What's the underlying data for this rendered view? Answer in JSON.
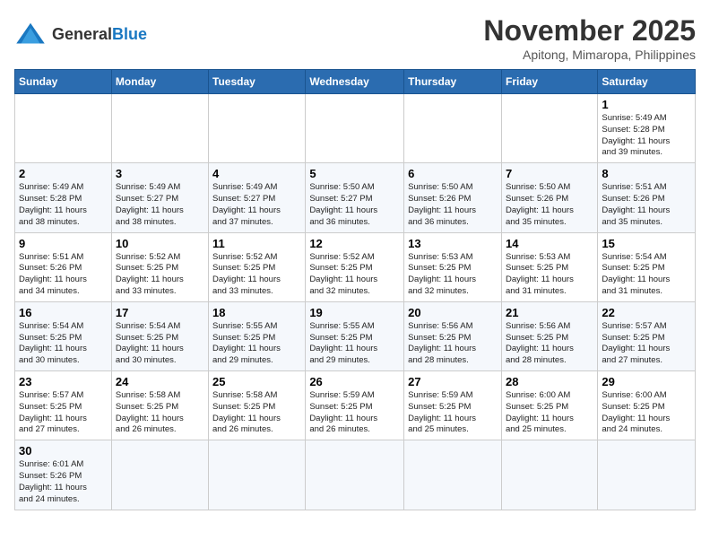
{
  "header": {
    "logo_general": "General",
    "logo_blue": "Blue",
    "month_title": "November 2025",
    "location": "Apitong, Mimaropa, Philippines"
  },
  "days_of_week": [
    "Sunday",
    "Monday",
    "Tuesday",
    "Wednesday",
    "Thursday",
    "Friday",
    "Saturday"
  ],
  "weeks": [
    [
      {
        "day": "",
        "info": ""
      },
      {
        "day": "",
        "info": ""
      },
      {
        "day": "",
        "info": ""
      },
      {
        "day": "",
        "info": ""
      },
      {
        "day": "",
        "info": ""
      },
      {
        "day": "",
        "info": ""
      },
      {
        "day": "1",
        "info": "Sunrise: 5:49 AM\nSunset: 5:28 PM\nDaylight: 11 hours\nand 39 minutes."
      }
    ],
    [
      {
        "day": "2",
        "info": "Sunrise: 5:49 AM\nSunset: 5:28 PM\nDaylight: 11 hours\nand 38 minutes."
      },
      {
        "day": "3",
        "info": "Sunrise: 5:49 AM\nSunset: 5:27 PM\nDaylight: 11 hours\nand 38 minutes."
      },
      {
        "day": "4",
        "info": "Sunrise: 5:49 AM\nSunset: 5:27 PM\nDaylight: 11 hours\nand 37 minutes."
      },
      {
        "day": "5",
        "info": "Sunrise: 5:50 AM\nSunset: 5:27 PM\nDaylight: 11 hours\nand 36 minutes."
      },
      {
        "day": "6",
        "info": "Sunrise: 5:50 AM\nSunset: 5:26 PM\nDaylight: 11 hours\nand 36 minutes."
      },
      {
        "day": "7",
        "info": "Sunrise: 5:50 AM\nSunset: 5:26 PM\nDaylight: 11 hours\nand 35 minutes."
      },
      {
        "day": "8",
        "info": "Sunrise: 5:51 AM\nSunset: 5:26 PM\nDaylight: 11 hours\nand 35 minutes."
      }
    ],
    [
      {
        "day": "9",
        "info": "Sunrise: 5:51 AM\nSunset: 5:26 PM\nDaylight: 11 hours\nand 34 minutes."
      },
      {
        "day": "10",
        "info": "Sunrise: 5:52 AM\nSunset: 5:25 PM\nDaylight: 11 hours\nand 33 minutes."
      },
      {
        "day": "11",
        "info": "Sunrise: 5:52 AM\nSunset: 5:25 PM\nDaylight: 11 hours\nand 33 minutes."
      },
      {
        "day": "12",
        "info": "Sunrise: 5:52 AM\nSunset: 5:25 PM\nDaylight: 11 hours\nand 32 minutes."
      },
      {
        "day": "13",
        "info": "Sunrise: 5:53 AM\nSunset: 5:25 PM\nDaylight: 11 hours\nand 32 minutes."
      },
      {
        "day": "14",
        "info": "Sunrise: 5:53 AM\nSunset: 5:25 PM\nDaylight: 11 hours\nand 31 minutes."
      },
      {
        "day": "15",
        "info": "Sunrise: 5:54 AM\nSunset: 5:25 PM\nDaylight: 11 hours\nand 31 minutes."
      }
    ],
    [
      {
        "day": "16",
        "info": "Sunrise: 5:54 AM\nSunset: 5:25 PM\nDaylight: 11 hours\nand 30 minutes."
      },
      {
        "day": "17",
        "info": "Sunrise: 5:54 AM\nSunset: 5:25 PM\nDaylight: 11 hours\nand 30 minutes."
      },
      {
        "day": "18",
        "info": "Sunrise: 5:55 AM\nSunset: 5:25 PM\nDaylight: 11 hours\nand 29 minutes."
      },
      {
        "day": "19",
        "info": "Sunrise: 5:55 AM\nSunset: 5:25 PM\nDaylight: 11 hours\nand 29 minutes."
      },
      {
        "day": "20",
        "info": "Sunrise: 5:56 AM\nSunset: 5:25 PM\nDaylight: 11 hours\nand 28 minutes."
      },
      {
        "day": "21",
        "info": "Sunrise: 5:56 AM\nSunset: 5:25 PM\nDaylight: 11 hours\nand 28 minutes."
      },
      {
        "day": "22",
        "info": "Sunrise: 5:57 AM\nSunset: 5:25 PM\nDaylight: 11 hours\nand 27 minutes."
      }
    ],
    [
      {
        "day": "23",
        "info": "Sunrise: 5:57 AM\nSunset: 5:25 PM\nDaylight: 11 hours\nand 27 minutes."
      },
      {
        "day": "24",
        "info": "Sunrise: 5:58 AM\nSunset: 5:25 PM\nDaylight: 11 hours\nand 26 minutes."
      },
      {
        "day": "25",
        "info": "Sunrise: 5:58 AM\nSunset: 5:25 PM\nDaylight: 11 hours\nand 26 minutes."
      },
      {
        "day": "26",
        "info": "Sunrise: 5:59 AM\nSunset: 5:25 PM\nDaylight: 11 hours\nand 26 minutes."
      },
      {
        "day": "27",
        "info": "Sunrise: 5:59 AM\nSunset: 5:25 PM\nDaylight: 11 hours\nand 25 minutes."
      },
      {
        "day": "28",
        "info": "Sunrise: 6:00 AM\nSunset: 5:25 PM\nDaylight: 11 hours\nand 25 minutes."
      },
      {
        "day": "29",
        "info": "Sunrise: 6:00 AM\nSunset: 5:25 PM\nDaylight: 11 hours\nand 24 minutes."
      }
    ],
    [
      {
        "day": "30",
        "info": "Sunrise: 6:01 AM\nSunset: 5:26 PM\nDaylight: 11 hours\nand 24 minutes."
      },
      {
        "day": "",
        "info": ""
      },
      {
        "day": "",
        "info": ""
      },
      {
        "day": "",
        "info": ""
      },
      {
        "day": "",
        "info": ""
      },
      {
        "day": "",
        "info": ""
      },
      {
        "day": "",
        "info": ""
      }
    ]
  ]
}
